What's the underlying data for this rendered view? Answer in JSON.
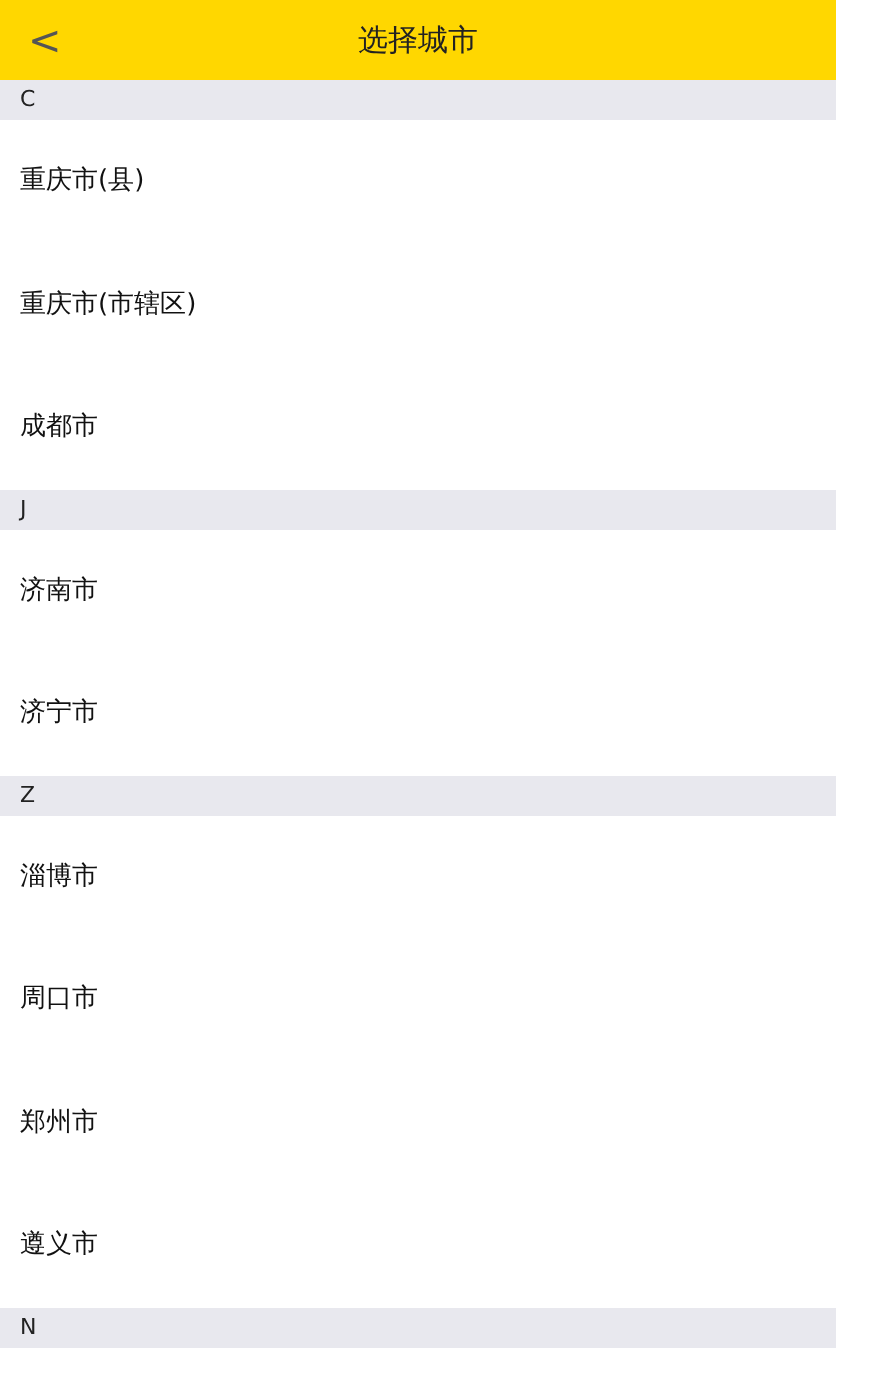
{
  "header": {
    "back": "<",
    "title": "选择城市"
  },
  "sections": [
    {
      "letter": "C",
      "cities": [
        "重庆市(县)",
        "重庆市(市辖区)",
        "成都市"
      ]
    },
    {
      "letter": "J",
      "cities": [
        "济南市",
        "济宁市"
      ]
    },
    {
      "letter": "Z",
      "cities": [
        "淄博市",
        "周口市",
        "郑州市",
        "遵义市"
      ]
    },
    {
      "letter": "N"
    }
  ]
}
